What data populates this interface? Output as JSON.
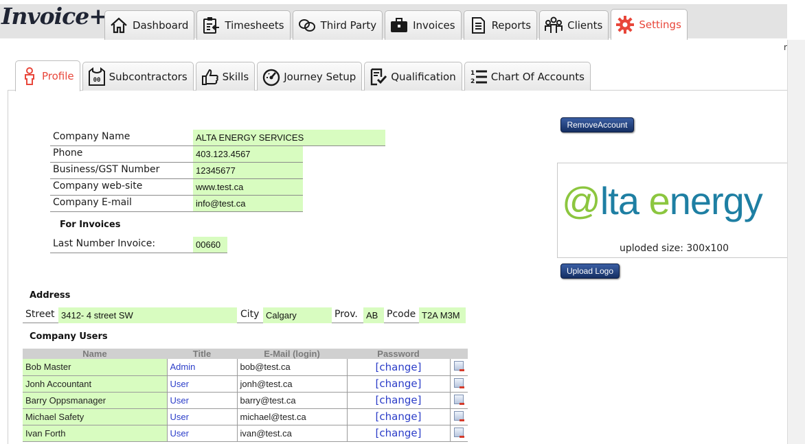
{
  "app": {
    "logo": "Invoice+"
  },
  "main_tabs": [
    {
      "label": "Dashboard",
      "icon": "home-icon"
    },
    {
      "label": "Timesheets",
      "icon": "timesheet-icon"
    },
    {
      "label": "Third Party",
      "icon": "link-icon"
    },
    {
      "label": "Invoices",
      "icon": "briefcase-icon"
    },
    {
      "label": "Reports",
      "icon": "report-icon"
    },
    {
      "label": "Clients",
      "icon": "clients-icon"
    },
    {
      "label": "Settings",
      "icon": "gear-icon",
      "active": true
    }
  ],
  "right_mark": "r",
  "sub_tabs": [
    {
      "label": "Profile",
      "icon": "person-icon",
      "active": true
    },
    {
      "label": "Subcontractors",
      "icon": "jersey-icon"
    },
    {
      "label": "Skills",
      "icon": "thumbs-up-icon"
    },
    {
      "label": "Journey Setup",
      "icon": "gauge-icon"
    },
    {
      "label": "Qualification",
      "icon": "checklist-icon"
    },
    {
      "label": "Chart Of Accounts",
      "icon": "numbered-list-icon"
    }
  ],
  "company": {
    "name_label": "Company Name",
    "name": "ALTA ENERGY SERVICES",
    "phone_label": "Phone",
    "phone": "403.123.4567",
    "gst_label": "Business/GST Number",
    "gst": "12345677",
    "website_label": "Company web-site",
    "website": "www.test.ca",
    "email_label": "Company E-mail",
    "email": "info@test.ca"
  },
  "invoices": {
    "heading": "For Invoices",
    "last_number_label": "Last Number Invoice:",
    "last_number": "00660"
  },
  "address": {
    "heading": "Address",
    "street_label": "Street",
    "street": "3412- 4 street SW",
    "city_label": "City",
    "city": "Calgary",
    "prov_label": "Prov.",
    "prov": "AB",
    "pcode_label": "Pcode",
    "pcode": "T2A M3M"
  },
  "users": {
    "heading": "Company Users",
    "columns": [
      "Name",
      "Title",
      "E-Mail (login)",
      "Password"
    ],
    "change_label": "[change]",
    "rows": [
      {
        "name": "Bob Master",
        "title": "Admin",
        "email": "bob@test.ca"
      },
      {
        "name": "Jonh Accountant",
        "title": "User",
        "email": "jonh@test.ca"
      },
      {
        "name": "Barry Oppsmanager",
        "title": "User",
        "email": "barry@test.ca"
      },
      {
        "name": "Michael Safety",
        "title": "User",
        "email": "michael@test.ca"
      },
      {
        "name": "Ivan Forth",
        "title": "User",
        "email": "ivan@test.ca"
      }
    ]
  },
  "account": {
    "remove_label": "RemoveAccount",
    "upload_label": "Upload Logo"
  },
  "logo_preview": {
    "text_at": "@",
    "text_lta": "lta ",
    "text_e": "e",
    "text_nergy": "nergy",
    "caption": "uploded size: 300x100"
  },
  "colors": {
    "accent": "#e8463a",
    "field_bg": "#d8fcc0",
    "button": "#1f3c7a",
    "link": "#2a3cc8"
  }
}
